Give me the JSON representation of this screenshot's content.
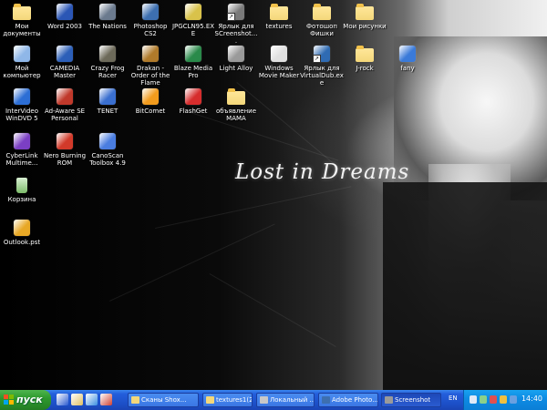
{
  "desktop": {
    "wallpaper_text": "Lost in Dreams",
    "icons": [
      {
        "id": "my-documents",
        "label": "Мои документы",
        "icon": "documents-folder-icon",
        "color": "#f4d77a"
      },
      {
        "id": "word-2003",
        "label": "Word 2003",
        "icon": "word-icon",
        "color": "#2b56b5"
      },
      {
        "id": "the-nations",
        "label": "The Nations",
        "icon": "game-icon",
        "color": "#6b7a8e"
      },
      {
        "id": "photoshop-cs2",
        "label": "Photoshop CS2",
        "icon": "photoshop-icon",
        "color": "#3d6fb0"
      },
      {
        "id": "jpgcln95",
        "label": "JPGCLN95.EXE",
        "icon": "exe-icon",
        "color": "#d9c24a"
      },
      {
        "id": "shortcut-screenshot",
        "label": "Ярлык для SCreenshot....",
        "icon": "shortcut-icon",
        "color": "#7a7a7a"
      },
      {
        "id": "textures",
        "label": "textures",
        "icon": "folder-icon",
        "color": "#f4d77a"
      },
      {
        "id": "photoshop-fichi",
        "label": "Фотошоп Фишки",
        "icon": "folder-icon",
        "color": "#f4d77a"
      },
      {
        "id": "my-pictures",
        "label": "Мои рисунки",
        "icon": "folder-icon",
        "color": "#f4d77a"
      },
      {
        "id": "my-computer",
        "label": "Мой компьютер",
        "icon": "computer-icon",
        "color": "#8fb7e8"
      },
      {
        "id": "camedia-master",
        "label": "CAMEDIA Master",
        "icon": "camera-icon",
        "color": "#2c5fb8"
      },
      {
        "id": "crazy-frog",
        "label": "Crazy Frog Racer",
        "icon": "frog-icon",
        "color": "#6d6a5a"
      },
      {
        "id": "drakan",
        "label": "Drakan - Order of the Flame",
        "icon": "drakan-icon",
        "color": "#b07a2a"
      },
      {
        "id": "blaze-media",
        "label": "Blaze Media Pro",
        "icon": "media-icon",
        "color": "#2a8a4a"
      },
      {
        "id": "light-alloy",
        "label": "Light Alloy",
        "icon": "player-icon",
        "color": "#9a9a9a"
      },
      {
        "id": "wmm",
        "label": "Windows Movie Maker",
        "icon": "movie-maker-icon",
        "color": "#e0e0e0"
      },
      {
        "id": "shortcut-virtualdub",
        "label": "Ярлык для VirtualDub.exe",
        "icon": "shortcut-icon",
        "color": "#2f6bb3"
      },
      {
        "id": "j-rock",
        "label": "J-rock",
        "icon": "folder-icon",
        "color": "#f4d77a"
      },
      {
        "id": "fany",
        "label": "fany",
        "icon": "file-icon",
        "color": "#3a7ad9"
      },
      {
        "id": "intervideo",
        "label": "InterVideo WinDVD 5",
        "icon": "dvd-icon",
        "color": "#2c6ed5"
      },
      {
        "id": "ad-aware",
        "label": "Ad-Aware SE Personal",
        "icon": "adaware-icon",
        "color": "#c0392b"
      },
      {
        "id": "tenet",
        "label": "TENET",
        "icon": "network-icon",
        "color": "#3a6fd0"
      },
      {
        "id": "bitcomet",
        "label": "BitComet",
        "icon": "bitcomet-icon",
        "color": "#f29b1d"
      },
      {
        "id": "flashget",
        "label": "FlashGet",
        "icon": "flashget-icon",
        "color": "#d62d2d"
      },
      {
        "id": "obyavlenie-mama",
        "label": "объявление МАМА",
        "icon": "folder-icon",
        "color": "#f4d77a"
      },
      {
        "id": "cyberlink",
        "label": "CyberLink Multime...",
        "icon": "cyberlink-icon",
        "color": "#7b3fc4"
      },
      {
        "id": "nero",
        "label": "Nero Burning ROM",
        "icon": "nero-icon",
        "color": "#d23a2a"
      },
      {
        "id": "canoscan",
        "label": "CanoScan Toolbox 4.9",
        "icon": "scanner-icon",
        "color": "#4a7de0"
      },
      {
        "id": "recycle-bin",
        "label": "Корзина",
        "icon": "recycle-bin-icon",
        "color": "#7dbb6a"
      },
      {
        "id": "outlook-pst",
        "label": "Outlook.pst",
        "icon": "outlook-icon",
        "color": "#e8a826"
      }
    ]
  },
  "taskbar": {
    "start_label": "пуск",
    "quick_launch": [
      {
        "icon": "media-player-icon",
        "color": "#2a5bd0"
      },
      {
        "icon": "desktop-icon",
        "color": "#e0c060"
      },
      {
        "icon": "browser-icon",
        "color": "#3a8ee0"
      },
      {
        "icon": "outlook-express-icon",
        "color": "#d04030"
      }
    ],
    "buttons": [
      {
        "label": "Сканы Shox...",
        "icon": "folder-icon",
        "color": "#f4d77a",
        "active": false
      },
      {
        "label": "textures1(2)",
        "icon": "folder-icon",
        "color": "#f4d77a",
        "active": false
      },
      {
        "label": "Локальный ...",
        "icon": "drive-icon",
        "color": "#c8c8c8",
        "active": false
      },
      {
        "label": "Adobe Photo...",
        "icon": "photoshop-icon",
        "color": "#3d6fb0",
        "active": false
      },
      {
        "label": "Screenshot",
        "icon": "screenshot-icon",
        "color": "#9a9a9a",
        "active": true
      }
    ],
    "language": "EN",
    "clock": "14:40"
  }
}
